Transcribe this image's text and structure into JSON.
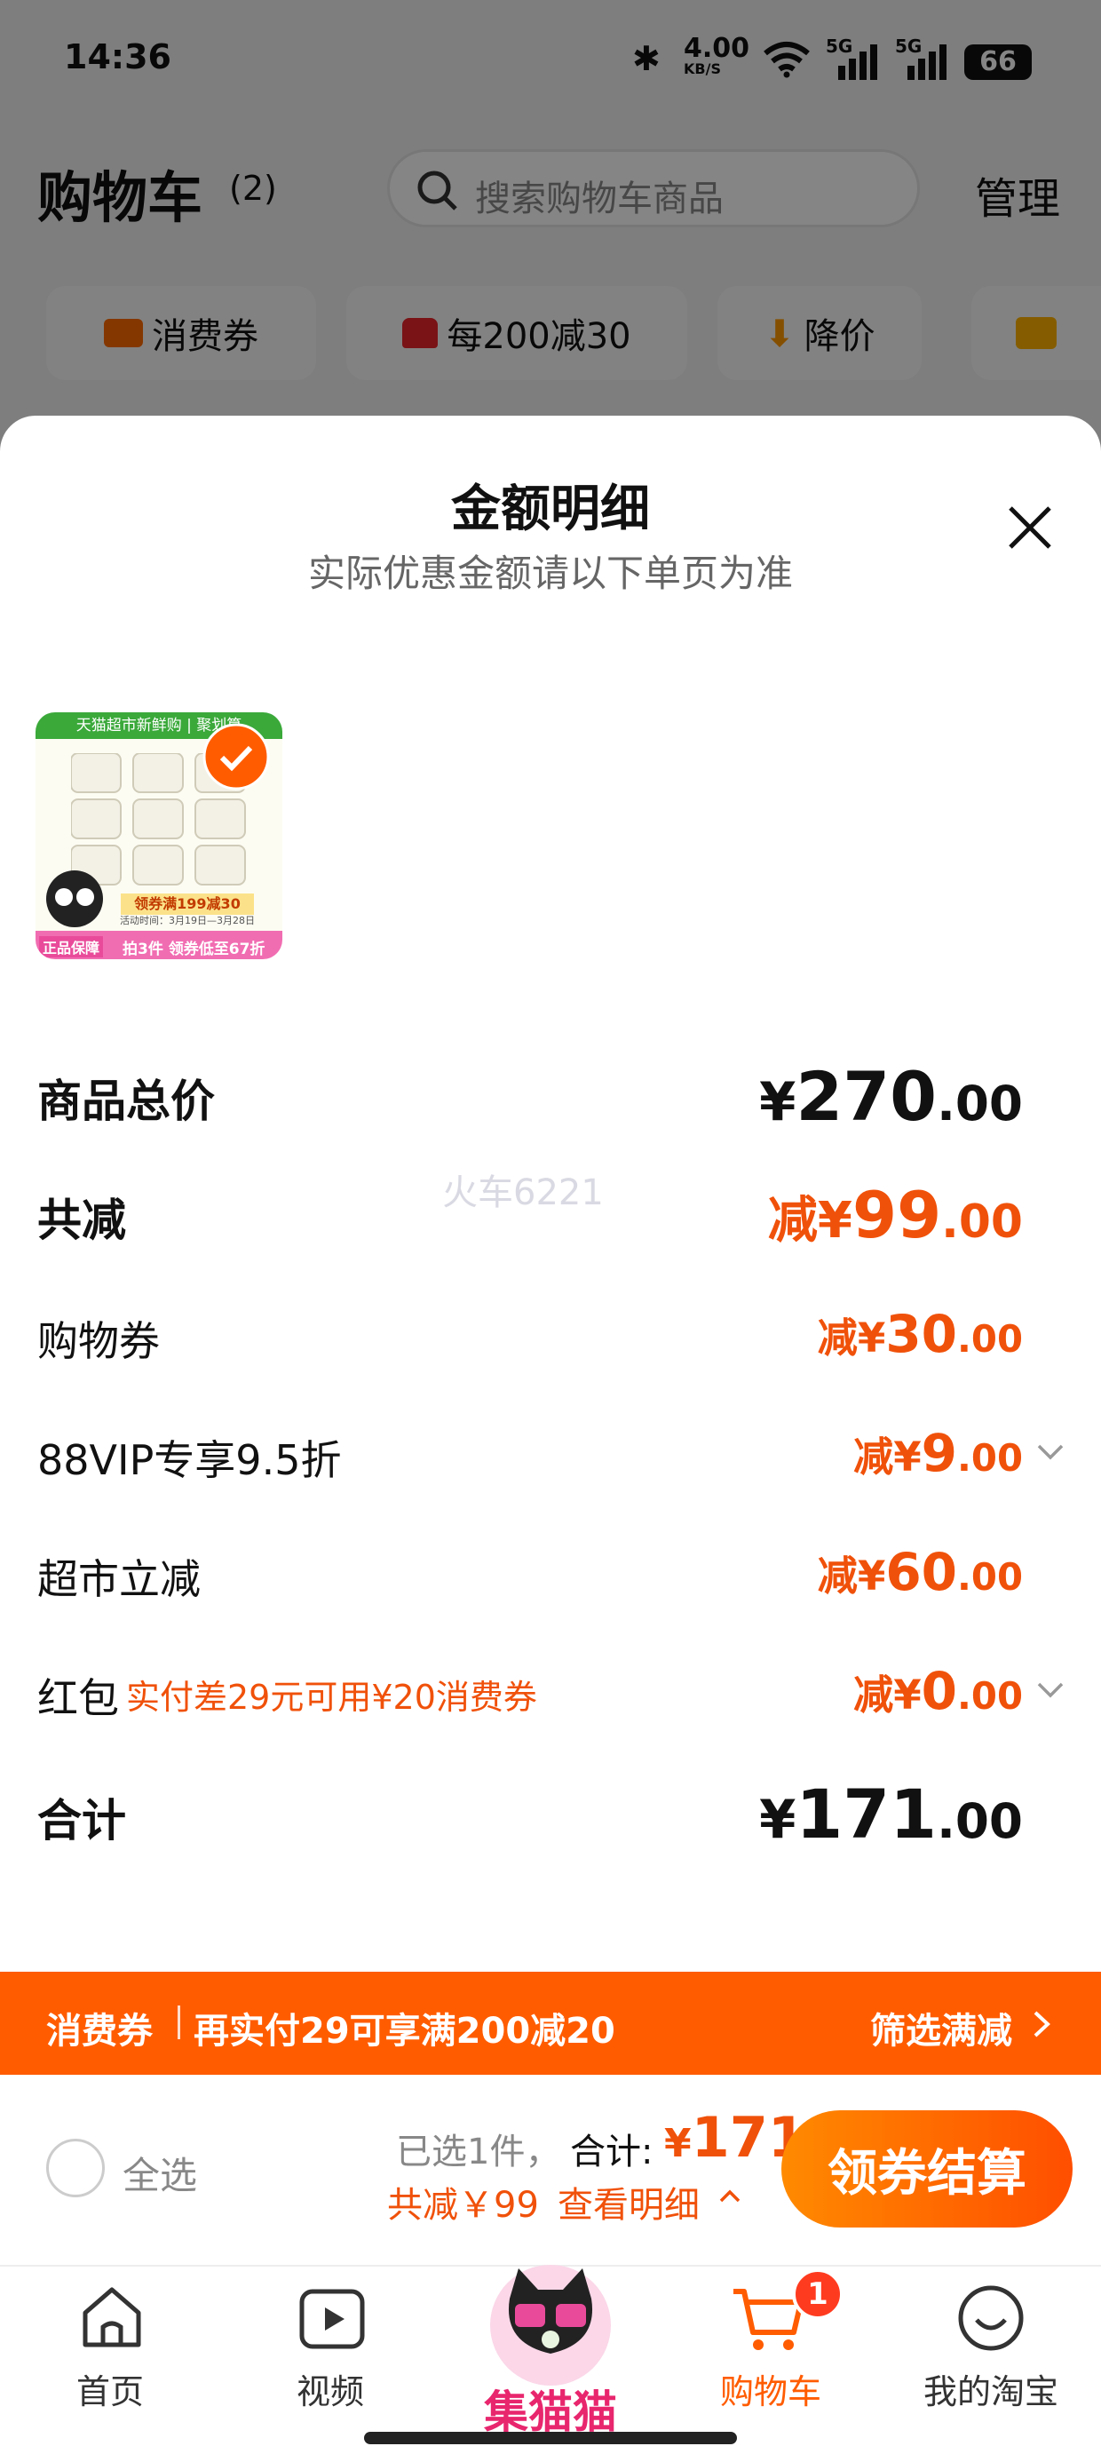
{
  "status_bar": {
    "time": "14:36",
    "speed": "4.00",
    "speed_unit": "KB/S",
    "net1": "5G",
    "net2": "5G",
    "battery": "66"
  },
  "header": {
    "title": "购物车",
    "count": "(2)",
    "search_placeholder": "搜索购物车商品",
    "manage": "管理"
  },
  "chips": [
    {
      "label": "消费券",
      "icon": "coupon-icon"
    },
    {
      "label": "每200减30",
      "icon": "shop-icon"
    },
    {
      "label": "降价",
      "icon": "price-drop-icon"
    },
    {
      "label": "",
      "icon": "folder-icon"
    }
  ],
  "sheet": {
    "title": "金额明细",
    "subtitle": "实际优惠金额请以下单页为准",
    "product_image": {
      "banner": "天猫超市新鲜购 | 聚划算",
      "promo": "领券满199减30",
      "promo_date": "活动时间：3月19日—3月28日",
      "bottom_left": "正品保障",
      "bottom_right": "拍3件 领券低至67折"
    },
    "rows": [
      {
        "label": "商品总价",
        "prefix": "",
        "currency": "¥",
        "int": "270",
        "dec": ".00"
      },
      {
        "label": "共减",
        "prefix": "减",
        "currency": "¥",
        "int": "99",
        "dec": ".00"
      },
      {
        "label": "购物券",
        "prefix": "减",
        "currency": "¥",
        "int": "30",
        "dec": ".00"
      },
      {
        "label": "88VIP专享9.5折",
        "prefix": "减",
        "currency": "¥",
        "int": "9",
        "dec": ".00"
      },
      {
        "label": "超市立减",
        "prefix": "减",
        "currency": "¥",
        "int": "60",
        "dec": ".00"
      },
      {
        "label": "红包",
        "note": "实付差29元可用¥20消费券",
        "prefix": "减",
        "currency": "¥",
        "int": "0",
        "dec": ".00"
      },
      {
        "label": "合计",
        "prefix": "",
        "currency": "¥",
        "int": "171",
        "dec": ".00"
      }
    ],
    "watermark": "火车6221"
  },
  "coupon_bar": {
    "tag": "消费券",
    "text": "再实付29可享满200减20",
    "action": "筛选满减"
  },
  "checkout": {
    "select_all": "全选",
    "selected": "已选1件，",
    "total_label": "合计:",
    "total_currency": "¥",
    "total_value": "171",
    "saved": "共减￥99",
    "view_detail": "查看明细",
    "button": "领券结算"
  },
  "tabbar": {
    "tabs": [
      {
        "label": "首页",
        "icon": "home-icon"
      },
      {
        "label": "视频",
        "icon": "video-icon"
      },
      {
        "label": "集猫猫",
        "icon": "tmall-cat-icon"
      },
      {
        "label": "购物车",
        "icon": "cart-icon",
        "badge": "1"
      },
      {
        "label": "我的淘宝",
        "icon": "profile-icon"
      }
    ]
  },
  "colors": {
    "accent": "#ff5c00",
    "price_orange": "#f0510a"
  }
}
